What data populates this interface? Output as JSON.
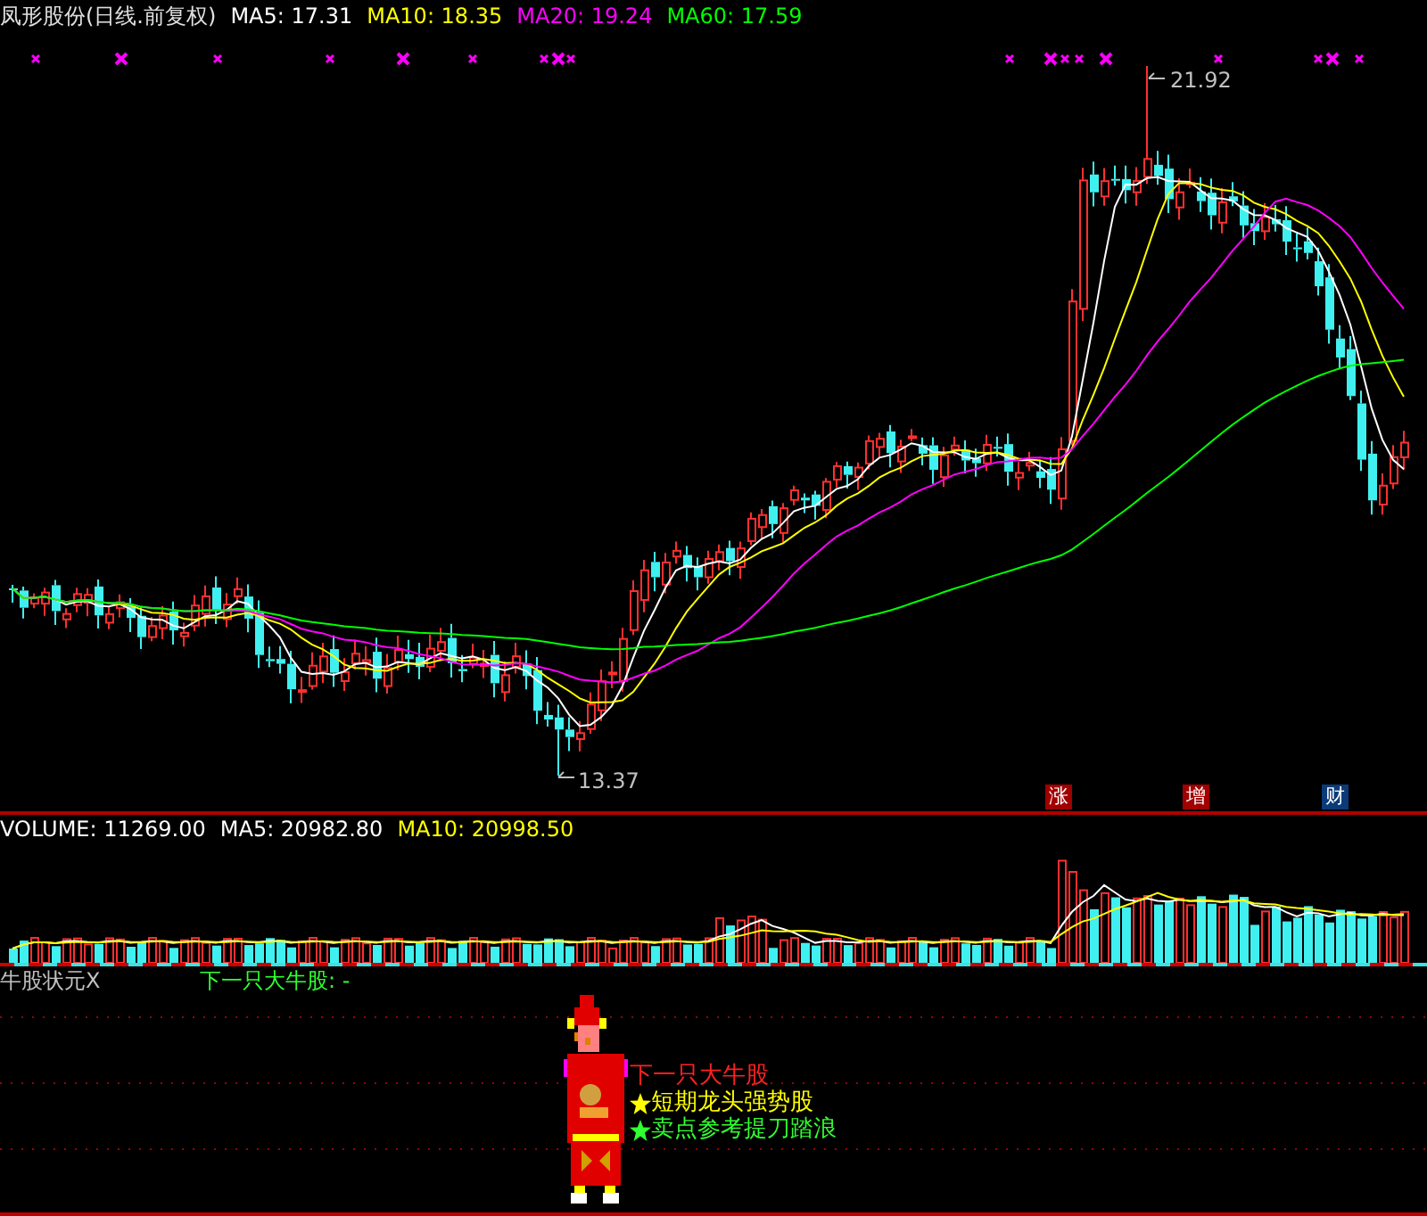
{
  "header": {
    "title": "凤形股份(日线.前复权)",
    "averages": [
      {
        "label": "MA5: 17.31",
        "color": "#ffffff"
      },
      {
        "label": "MA10: 18.35",
        "color": "#ffff00"
      },
      {
        "label": "MA20: 19.24",
        "color": "#ff00ff"
      },
      {
        "label": "MA60: 17.59",
        "color": "#00ff00"
      }
    ]
  },
  "price_chart": {
    "high_label": "21.92",
    "low_label": "13.37",
    "signals": [
      {
        "label": "涨",
        "color": "#a00000"
      },
      {
        "label": "增",
        "color": "#a00000"
      },
      {
        "label": "财",
        "color": "#0a3a78"
      }
    ]
  },
  "volume": {
    "labels": [
      {
        "label": "VOLUME: 11269.00",
        "color": "#ffffff"
      },
      {
        "label": "MA5: 20982.80",
        "color": "#ffffff"
      },
      {
        "label": "MA10: 20998.50",
        "color": "#ffff00"
      }
    ]
  },
  "indicator": {
    "name": "牛股状元X",
    "value": "下一只大牛股: -",
    "notes": [
      {
        "text": "下一只大牛股",
        "color": "#ff2020",
        "starred": false
      },
      {
        "text": "短期龙头强势股",
        "color": "#ffff00",
        "starred": true
      },
      {
        "text": "卖点参考提刀踏浪",
        "color": "#30ff30",
        "starred": true
      }
    ]
  }
}
